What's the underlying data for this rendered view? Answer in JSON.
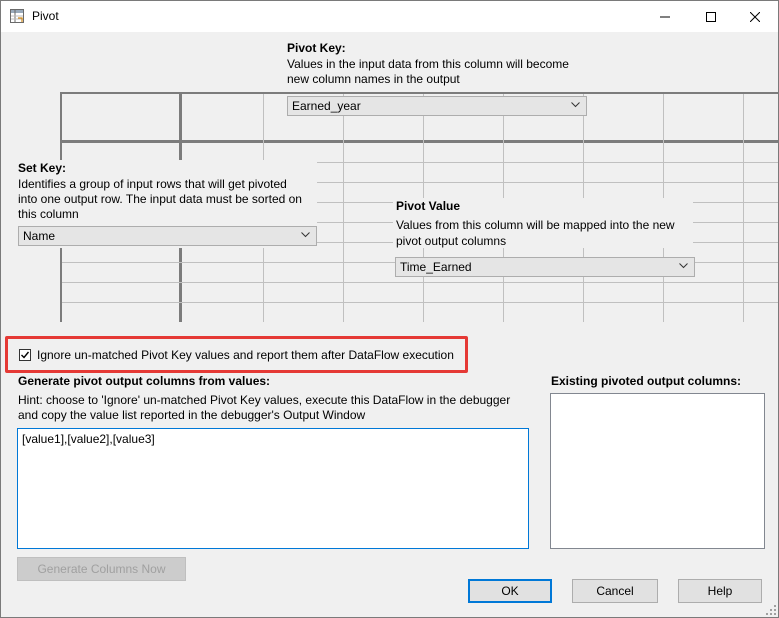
{
  "window": {
    "title": "Pivot"
  },
  "pivot_key": {
    "heading": "Pivot Key:",
    "desc1": "Values in the input data from this column will become",
    "desc2": "new column names in the output",
    "value": "Earned_year"
  },
  "set_key": {
    "heading": "Set Key:",
    "desc1": "Identifies a group of input rows that will get pivoted",
    "desc2": "into one output row. The input data must be sorted on",
    "desc3": "this column",
    "value": "Name"
  },
  "pivot_value": {
    "heading": "Pivot Value",
    "desc1": "Values from this column will be mapped into the new",
    "desc2": "pivot output columns",
    "value": "Time_Earned"
  },
  "ignore_checkbox": {
    "label": "Ignore un-matched Pivot Key values and report them after DataFlow execution",
    "checked": true
  },
  "generate": {
    "heading": "Generate pivot output columns from values:",
    "hint1": "Hint: choose to 'Ignore' un-matched Pivot Key values, execute this DataFlow in the debugger",
    "hint2": "and copy the value list reported in the debugger's Output Window",
    "text": "[value1],[value2],[value3]",
    "button": "Generate Columns Now"
  },
  "existing": {
    "heading": "Existing pivoted output columns:"
  },
  "buttons": {
    "ok": "OK",
    "cancel": "Cancel",
    "help": "Help"
  },
  "colors": {
    "accent": "#0078d7",
    "highlight": "#e53935"
  }
}
